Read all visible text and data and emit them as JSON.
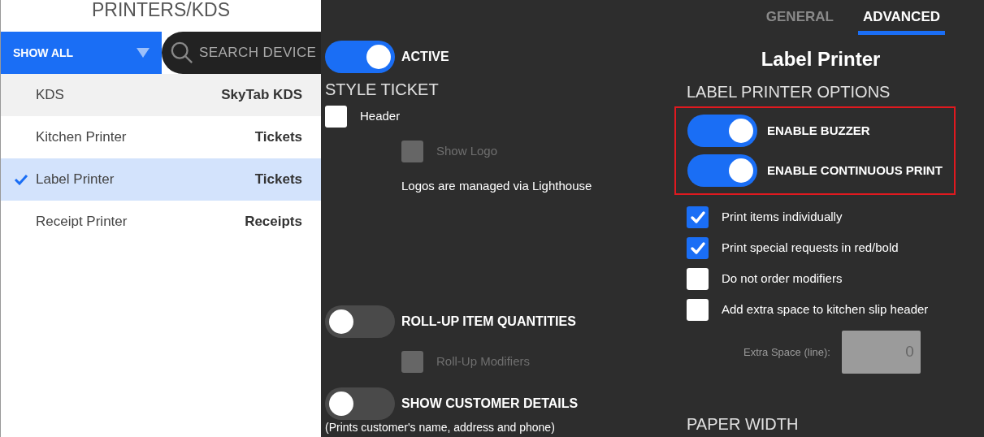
{
  "sidebar": {
    "title": "PRINTERS/KDS",
    "filter": {
      "label": "SHOW ALL"
    },
    "search": {
      "placeholder": "SEARCH DEVICE"
    },
    "items": [
      {
        "name": "KDS",
        "type": "SkyTab KDS",
        "selected": false,
        "hovered": true
      },
      {
        "name": "Kitchen Printer",
        "type": "Tickets",
        "selected": false,
        "hovered": false
      },
      {
        "name": "Label Printer",
        "type": "Tickets",
        "selected": true,
        "hovered": false
      },
      {
        "name": "Receipt Printer",
        "type": "Receipts",
        "selected": false,
        "hovered": false
      }
    ]
  },
  "tabs": [
    {
      "label": "GENERAL",
      "selected": false
    },
    {
      "label": "ADVANCED",
      "selected": true
    }
  ],
  "settings": [
    {
      "kind": "toggle",
      "label": "ACTIVE",
      "on": true
    },
    {
      "kind": "heading",
      "label": "STYLE TICKET"
    },
    {
      "kind": "checkbox",
      "label": "Header",
      "checked": false,
      "disabled": false,
      "children": [
        {
          "kind": "checkbox",
          "label": "Show Logo",
          "checked": false,
          "disabled": true
        },
        {
          "kind": "note",
          "label": "Logos are managed via Lighthouse"
        }
      ]
    },
    {
      "kind": "toggle",
      "label": "ROLL-UP ITEM QUANTITIES",
      "on": false,
      "children": [
        {
          "kind": "checkbox",
          "label": "Roll-Up Modifiers",
          "checked": false,
          "disabled": true
        }
      ]
    },
    {
      "kind": "toggle",
      "label": "SHOW CUSTOMER DETAILS",
      "on": false,
      "note": "(Prints customer's name, address and phone)"
    }
  ],
  "printer": {
    "title": "Label Printer",
    "options_heading": "LABEL PRINTER OPTIONS",
    "highlighted": true,
    "toggles": [
      {
        "label": "ENABLE BUZZER",
        "on": true
      },
      {
        "label": "ENABLE CONTINUOUS PRINT",
        "on": true
      }
    ],
    "checkboxes": [
      {
        "label": "Print items individually",
        "checked": true
      },
      {
        "label": "Print special requests in red/bold",
        "checked": true
      },
      {
        "label": "Do not order modifiers",
        "checked": false
      },
      {
        "label": "Add extra space to kitchen slip header",
        "checked": false
      }
    ],
    "extra_space": {
      "label": "Extra Space (line):",
      "value": "0",
      "disabled": true
    },
    "paper_width_heading": "PAPER WIDTH"
  }
}
